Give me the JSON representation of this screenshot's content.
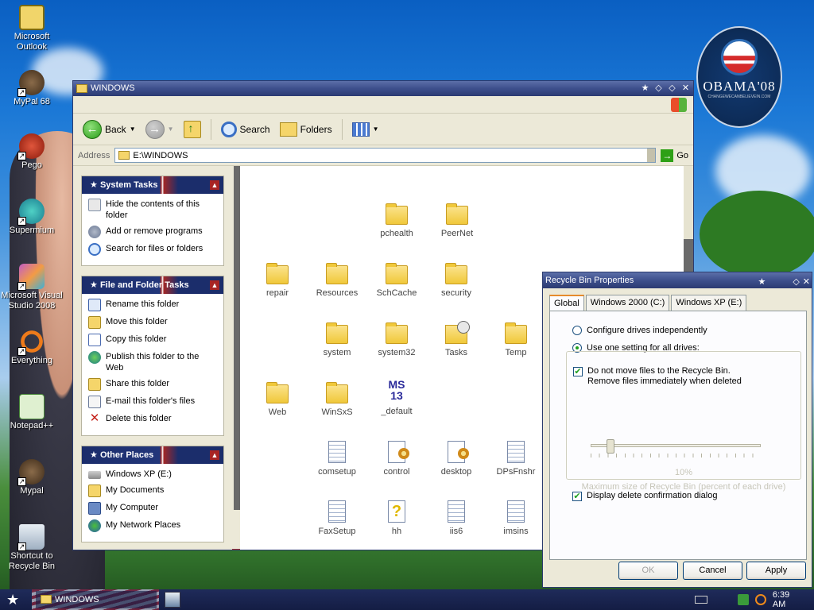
{
  "desktop": {
    "icons": [
      {
        "label": "Microsoft Outlook"
      },
      {
        "label": "MyPal 68"
      },
      {
        "label": "Pego"
      },
      {
        "label": "Supermium"
      },
      {
        "label": "Microsoft Visual Studio 2008"
      },
      {
        "label": "Everything"
      },
      {
        "label": "Notepad++"
      },
      {
        "label": "Mypal"
      },
      {
        "label": "Shortcut to Recycle Bin"
      }
    ],
    "logo": {
      "text": "OBAMA'08",
      "sub": "CHANGEWECANBELIEVEIN.COM"
    }
  },
  "explorer": {
    "title": "WINDOWS",
    "toolbar": {
      "back_label": "Back",
      "search_label": "Search",
      "folders_label": "Folders"
    },
    "address": {
      "label": "Address",
      "value": "E:\\WINDOWS",
      "go_label": "Go"
    },
    "panels": {
      "system_tasks": {
        "title": "System Tasks",
        "items": [
          "Hide the contents of this folder",
          "Add or remove programs",
          "Search for files or folders"
        ]
      },
      "file_folder_tasks": {
        "title": "File and Folder Tasks",
        "items": [
          "Rename this folder",
          "Move this folder",
          "Copy this folder",
          "Publish this folder to the Web",
          "Share this folder",
          "E-mail this folder's files",
          "Delete this folder"
        ]
      },
      "other_places": {
        "title": "Other Places",
        "items": [
          "Windows XP (E:)",
          "My Documents",
          "My Computer",
          "My Network Places"
        ]
      }
    },
    "files": [
      {
        "name": "pchealth",
        "icon": "folder"
      },
      {
        "name": "PeerNet",
        "icon": "folder"
      },
      {
        "name": "repair",
        "icon": "folder"
      },
      {
        "name": "Resources",
        "icon": "folder"
      },
      {
        "name": "SchCache",
        "icon": "folder"
      },
      {
        "name": "security",
        "icon": "folder"
      },
      {
        "name": "system",
        "icon": "folder"
      },
      {
        "name": "system32",
        "icon": "folder"
      },
      {
        "name": "Tasks",
        "icon": "tasks-folder"
      },
      {
        "name": "Temp",
        "icon": "folder"
      },
      {
        "name": "Web",
        "icon": "folder"
      },
      {
        "name": "WinSxS",
        "icon": "folder"
      },
      {
        "name": "_default",
        "icon": "msi"
      },
      {
        "name": "comsetup",
        "icon": "text-file"
      },
      {
        "name": "control",
        "icon": "config-file"
      },
      {
        "name": "desktop",
        "icon": "config-file"
      },
      {
        "name": "DPsFnshr",
        "icon": "text-file"
      },
      {
        "name": "FaxSetup",
        "icon": "text-file"
      },
      {
        "name": "hh",
        "icon": "help-file"
      },
      {
        "name": "iis6",
        "icon": "text-file"
      },
      {
        "name": "imsins",
        "icon": "text-file"
      }
    ]
  },
  "dialog": {
    "title": "Recycle Bin Properties",
    "tabs": [
      "Global",
      "Windows 2000 (C:)",
      "Windows XP (E:)"
    ],
    "radio_independent": "Configure drives independently",
    "radio_one_setting": "Use one setting for all drives:",
    "check_no_move": "Do not move files to the Recycle Bin.",
    "check_no_move_2": "Remove files immediately when deleted",
    "slider_value": "10%",
    "slider_caption": "Maximum size of Recycle Bin (percent of each drive)",
    "check_confirm": "Display delete confirmation dialog",
    "buttons": {
      "ok": "OK",
      "cancel": "Cancel",
      "apply": "Apply"
    }
  },
  "taskbar": {
    "task_label": "WINDOWS",
    "clock": "6:39 AM"
  }
}
